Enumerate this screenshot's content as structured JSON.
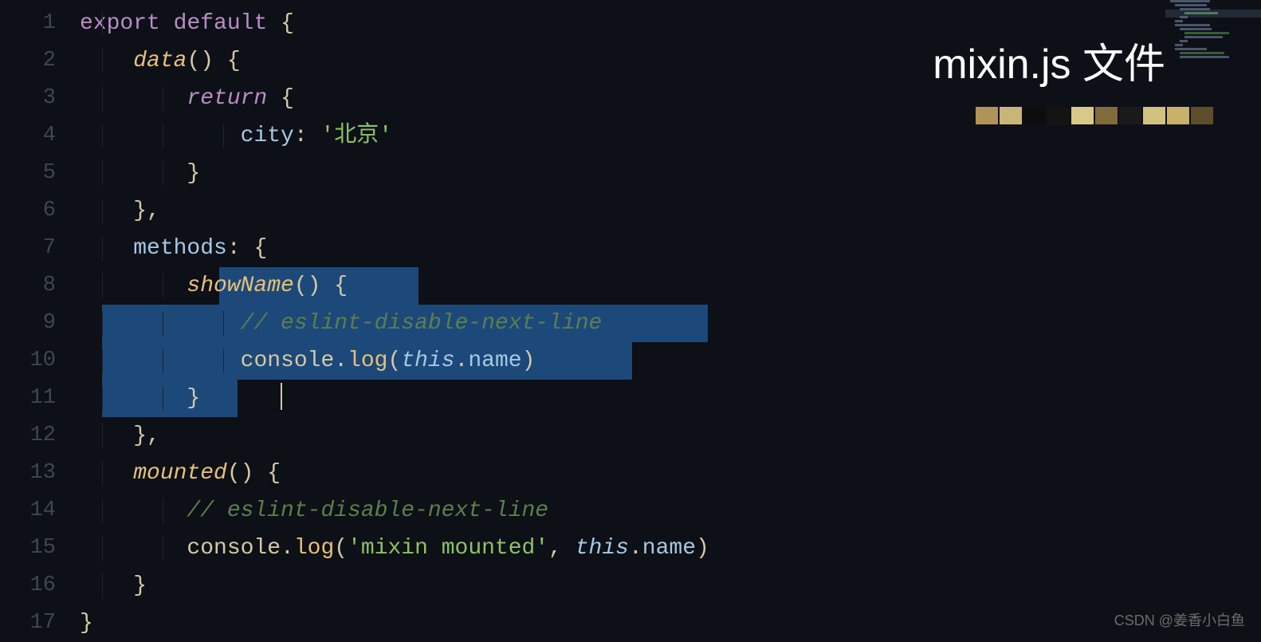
{
  "title_label": "mixin.js 文件",
  "watermark": "CSDN @姜香小白鱼",
  "line_numbers": [
    "1",
    "2",
    "3",
    "4",
    "5",
    "6",
    "7",
    "8",
    "9",
    "10",
    "11",
    "12",
    "13",
    "14",
    "15",
    "16",
    "17"
  ],
  "tokens": {
    "export": "export",
    "default": "default",
    "lbrace": "{",
    "rbrace": "}",
    "lparen": "(",
    "rparen": ")",
    "comma": ",",
    "colon": ":",
    "data": "data",
    "return": "return",
    "city": "city",
    "beijing": "'北京'",
    "methods": "methods",
    "showName": "showName",
    "eslint_comment": "// eslint-disable-next-line",
    "console": "console",
    "log": "log",
    "this": "this",
    "name": "name",
    "dot": ".",
    "mounted": "mounted",
    "mixin_mounted_str": "'mixin mounted'",
    "space_comma": ", "
  },
  "pixel_colors": [
    "#b09358",
    "#c9b577",
    "#0d0d0d",
    "#141414",
    "#d8c98a",
    "#826a3a",
    "#1a1a1a",
    "#d2c17f",
    "#c9b16a",
    "#5e4d2b"
  ]
}
